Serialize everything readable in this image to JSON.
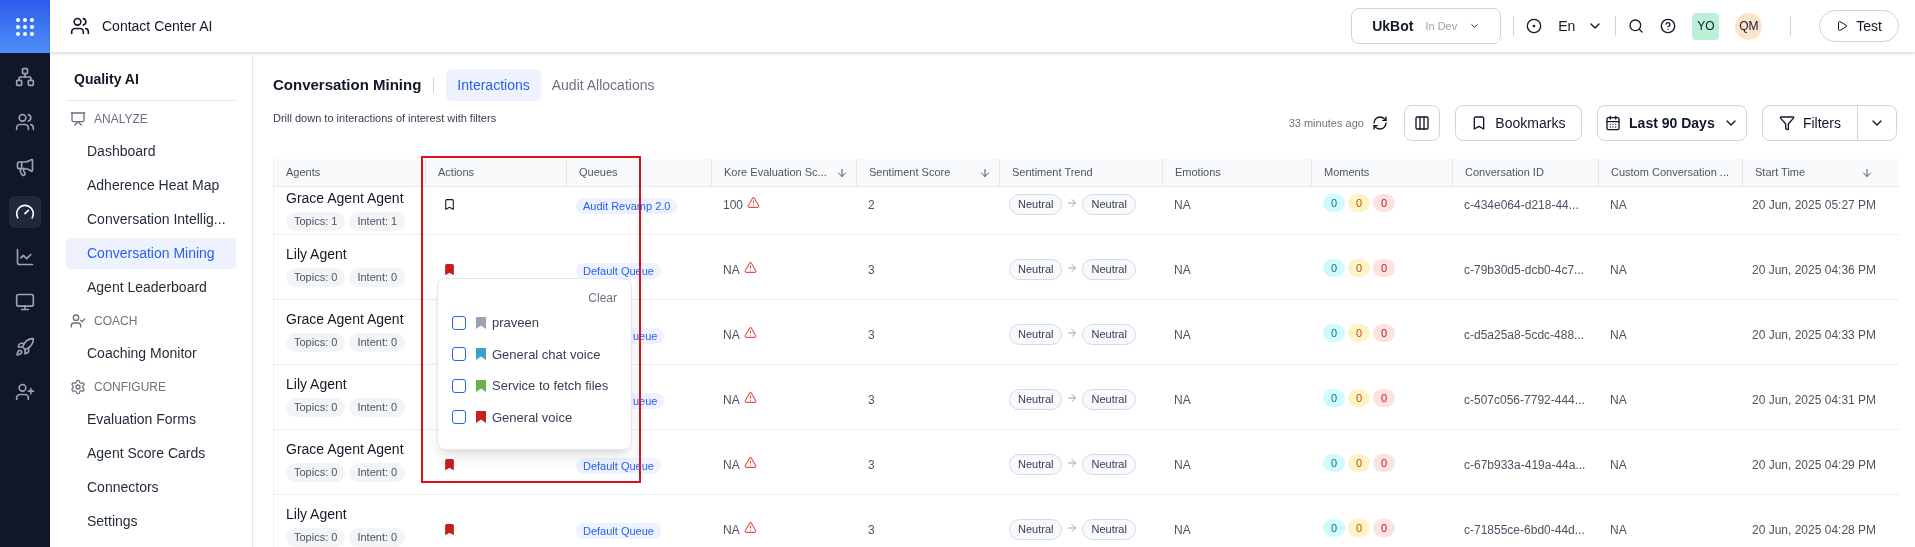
{
  "app": {
    "title": "Contact Center AI"
  },
  "topbar": {
    "bot": {
      "name": "UkBot",
      "env": "In Dev"
    },
    "language": "En",
    "avatars": [
      {
        "initials": "YO",
        "color": "#bbf0d6"
      },
      {
        "initials": "QM",
        "color": "#fde3cc"
      }
    ],
    "test_button": "Test"
  },
  "sidebar": {
    "title": "Quality AI",
    "sections": [
      {
        "kind": "analyze",
        "label": "ANALYZE",
        "items": [
          {
            "label": "Dashboard",
            "selected": false
          },
          {
            "label": "Adherence Heat Map",
            "selected": false
          },
          {
            "label": "Conversation Intellig...",
            "selected": false
          },
          {
            "label": "Conversation Mining",
            "selected": true
          },
          {
            "label": "Agent Leaderboard",
            "selected": false
          }
        ]
      },
      {
        "kind": "coach",
        "label": "COACH",
        "items": [
          {
            "label": "Coaching Monitor",
            "selected": false
          }
        ]
      },
      {
        "kind": "configure",
        "label": "CONFIGURE",
        "items": [
          {
            "label": "Evaluation Forms",
            "selected": false
          },
          {
            "label": "Agent Score Cards",
            "selected": false
          },
          {
            "label": "Connectors",
            "selected": false
          },
          {
            "label": "Settings",
            "selected": false
          }
        ]
      }
    ]
  },
  "page": {
    "title": "Conversation Mining",
    "tabs": [
      {
        "label": "Interactions",
        "selected": true
      },
      {
        "label": "Audit Allocations",
        "selected": false
      }
    ],
    "subtitle": "Drill down to interactions of interest with filters",
    "updated": "33 minutes ago",
    "bookmarks_button": "Bookmarks",
    "date_range": "Last 90 Days",
    "filters_button": "Filters"
  },
  "table": {
    "columns": [
      {
        "label": "Agents",
        "sortable": false
      },
      {
        "label": "Actions",
        "sortable": false
      },
      {
        "label": "Queues",
        "sortable": false
      },
      {
        "label": "Kore Evaluation Sc...",
        "sortable": true
      },
      {
        "label": "Sentiment Score",
        "sortable": true
      },
      {
        "label": "Sentiment Trend",
        "sortable": false
      },
      {
        "label": "Emotions",
        "sortable": false
      },
      {
        "label": "Moments",
        "sortable": false
      },
      {
        "label": "Conversation ID",
        "sortable": false
      },
      {
        "label": "Custom Conversation ...",
        "sortable": false
      },
      {
        "label": "Start Time",
        "sortable": true
      }
    ],
    "rows": [
      {
        "agent": "Grace Agent Agent",
        "topics": "Topics: 1",
        "intent": "Intent: 1",
        "bookmarked": false,
        "queue": "Audit Revamp 2.0",
        "queue_covered": false,
        "score": "100",
        "sentiment": "2",
        "trend_from": "Neutral",
        "trend_to": "Neutral",
        "emotions": "NA",
        "moments": [
          {
            "value": "0",
            "color": "#cffafe"
          },
          {
            "value": "0",
            "color": "#fef3c7"
          },
          {
            "value": "0",
            "color": "#fee2e2"
          }
        ],
        "conversation_id": "c-434e064-d218-44...",
        "custom": "NA",
        "start_time": "20 Jun, 2025 05:27 PM"
      },
      {
        "agent": "Lily Agent",
        "topics": "Topics: 0",
        "intent": "Intent: 0",
        "bookmarked": true,
        "queue": "Default Queue",
        "queue_covered": false,
        "score": "NA",
        "sentiment": "3",
        "trend_from": "Neutral",
        "trend_to": "Neutral",
        "emotions": "NA",
        "moments": [
          {
            "value": "0",
            "color": "#cffafe"
          },
          {
            "value": "0",
            "color": "#fef3c7"
          },
          {
            "value": "0",
            "color": "#fee2e2"
          }
        ],
        "conversation_id": "c-79b30d5-dcb0-4c7...",
        "custom": "NA",
        "start_time": "20 Jun, 2025 04:36 PM"
      },
      {
        "agent": "Grace Agent Agent",
        "topics": "Topics: 0",
        "intent": "Intent: 0",
        "queue": "ueue",
        "queue_covered": true,
        "score": "NA",
        "sentiment": "3",
        "trend_from": "Neutral",
        "trend_to": "Neutral",
        "emotions": "NA",
        "moments": [
          {
            "value": "0",
            "color": "#cffafe"
          },
          {
            "value": "0",
            "color": "#fef3c7"
          },
          {
            "value": "0",
            "color": "#fee2e2"
          }
        ],
        "conversation_id": "c-d5a25a8-5cdc-488...",
        "custom": "NA",
        "start_time": "20 Jun, 2025 04:33 PM"
      },
      {
        "agent": "Lily Agent",
        "topics": "Topics: 0",
        "intent": "Intent: 0",
        "queue": "ueue",
        "queue_covered": true,
        "score": "NA",
        "sentiment": "3",
        "trend_from": "Neutral",
        "trend_to": "Neutral",
        "emotions": "NA",
        "moments": [
          {
            "value": "0",
            "color": "#cffafe"
          },
          {
            "value": "0",
            "color": "#fef3c7"
          },
          {
            "value": "0",
            "color": "#fee2e2"
          }
        ],
        "conversation_id": "c-507c056-7792-444...",
        "custom": "NA",
        "start_time": "20 Jun, 2025 04:31 PM"
      },
      {
        "agent": "Grace Agent Agent",
        "topics": "Topics: 0",
        "intent": "Intent: 0",
        "bookmarked": true,
        "queue": "Default Queue",
        "queue_covered": false,
        "score": "NA",
        "sentiment": "3",
        "trend_from": "Neutral",
        "trend_to": "Neutral",
        "emotions": "NA",
        "moments": [
          {
            "value": "0",
            "color": "#cffafe"
          },
          {
            "value": "0",
            "color": "#fef3c7"
          },
          {
            "value": "0",
            "color": "#fee2e2"
          }
        ],
        "conversation_id": "c-67b933a-419a-44a...",
        "custom": "NA",
        "start_time": "20 Jun, 2025 04:29 PM"
      },
      {
        "agent": "Lily Agent",
        "topics": "Topics: 0",
        "intent": "Intent: 0",
        "bookmarked": true,
        "queue": "Default Queue",
        "queue_covered": false,
        "score": "NA",
        "sentiment": "3",
        "trend_from": "Neutral",
        "trend_to": "Neutral",
        "emotions": "NA",
        "moments": [
          {
            "value": "0",
            "color": "#cffafe"
          },
          {
            "value": "0",
            "color": "#fef3c7"
          },
          {
            "value": "0",
            "color": "#fee2e2"
          }
        ],
        "conversation_id": "c-71855ce-6bd0-44d...",
        "custom": "NA",
        "start_time": "20 Jun, 2025 04:28 PM"
      }
    ]
  },
  "bookmark_menu": {
    "clear": "Clear",
    "options": [
      {
        "label": "praveen",
        "color": "#9ca3af",
        "checked": false
      },
      {
        "label": "General chat voice",
        "color": "#38a3c9",
        "checked": false
      },
      {
        "label": "Service to fetch files",
        "color": "#6ab04c",
        "checked": false
      },
      {
        "label": "General voice",
        "color": "#c81e1e",
        "checked": false
      }
    ]
  }
}
